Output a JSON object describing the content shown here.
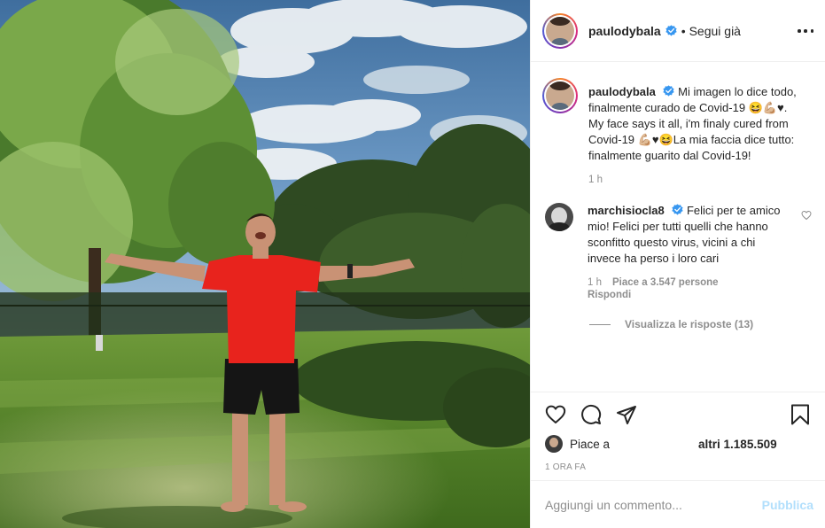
{
  "post": {
    "username": "paulodybala",
    "follow_state": "Segui già",
    "caption": "Mi imagen lo dice todo, finalmente curado de Covid-19 😆💪🏼♥. My face says it all, i'm finaly cured from Covid-19 💪🏼♥😆La mia faccia dice tutto: finalmente guarito dal Covid-19!",
    "caption_time": "1 h",
    "timestamp": "1 ORA FA"
  },
  "comment": {
    "username": "marchisiocla8",
    "text": "Felici per te amico mio! Felici per tutti quelli che hanno sconfitto questo virus, vicini a chi invece ha perso i loro cari",
    "time": "1 h",
    "likes": "Piace a 3.547 persone",
    "reply_label": "Rispondi",
    "view_replies": "Visualizza le risposte (13)"
  },
  "likes": {
    "prefix": "Piace a",
    "others": "altri 1.185.509"
  },
  "add_comment": {
    "placeholder": "Aggiungi un commento...",
    "publish_label": "Pubblica"
  },
  "icons": {
    "verified": "verified-badge-icon",
    "more": "more-options-icon",
    "like": "heart-icon",
    "comment": "comment-icon",
    "share": "share-icon",
    "save": "bookmark-icon"
  },
  "colors": {
    "verified_blue": "#3897f0",
    "publish_disabled": "#b2dffc",
    "shirt_red": "#e8231d"
  }
}
